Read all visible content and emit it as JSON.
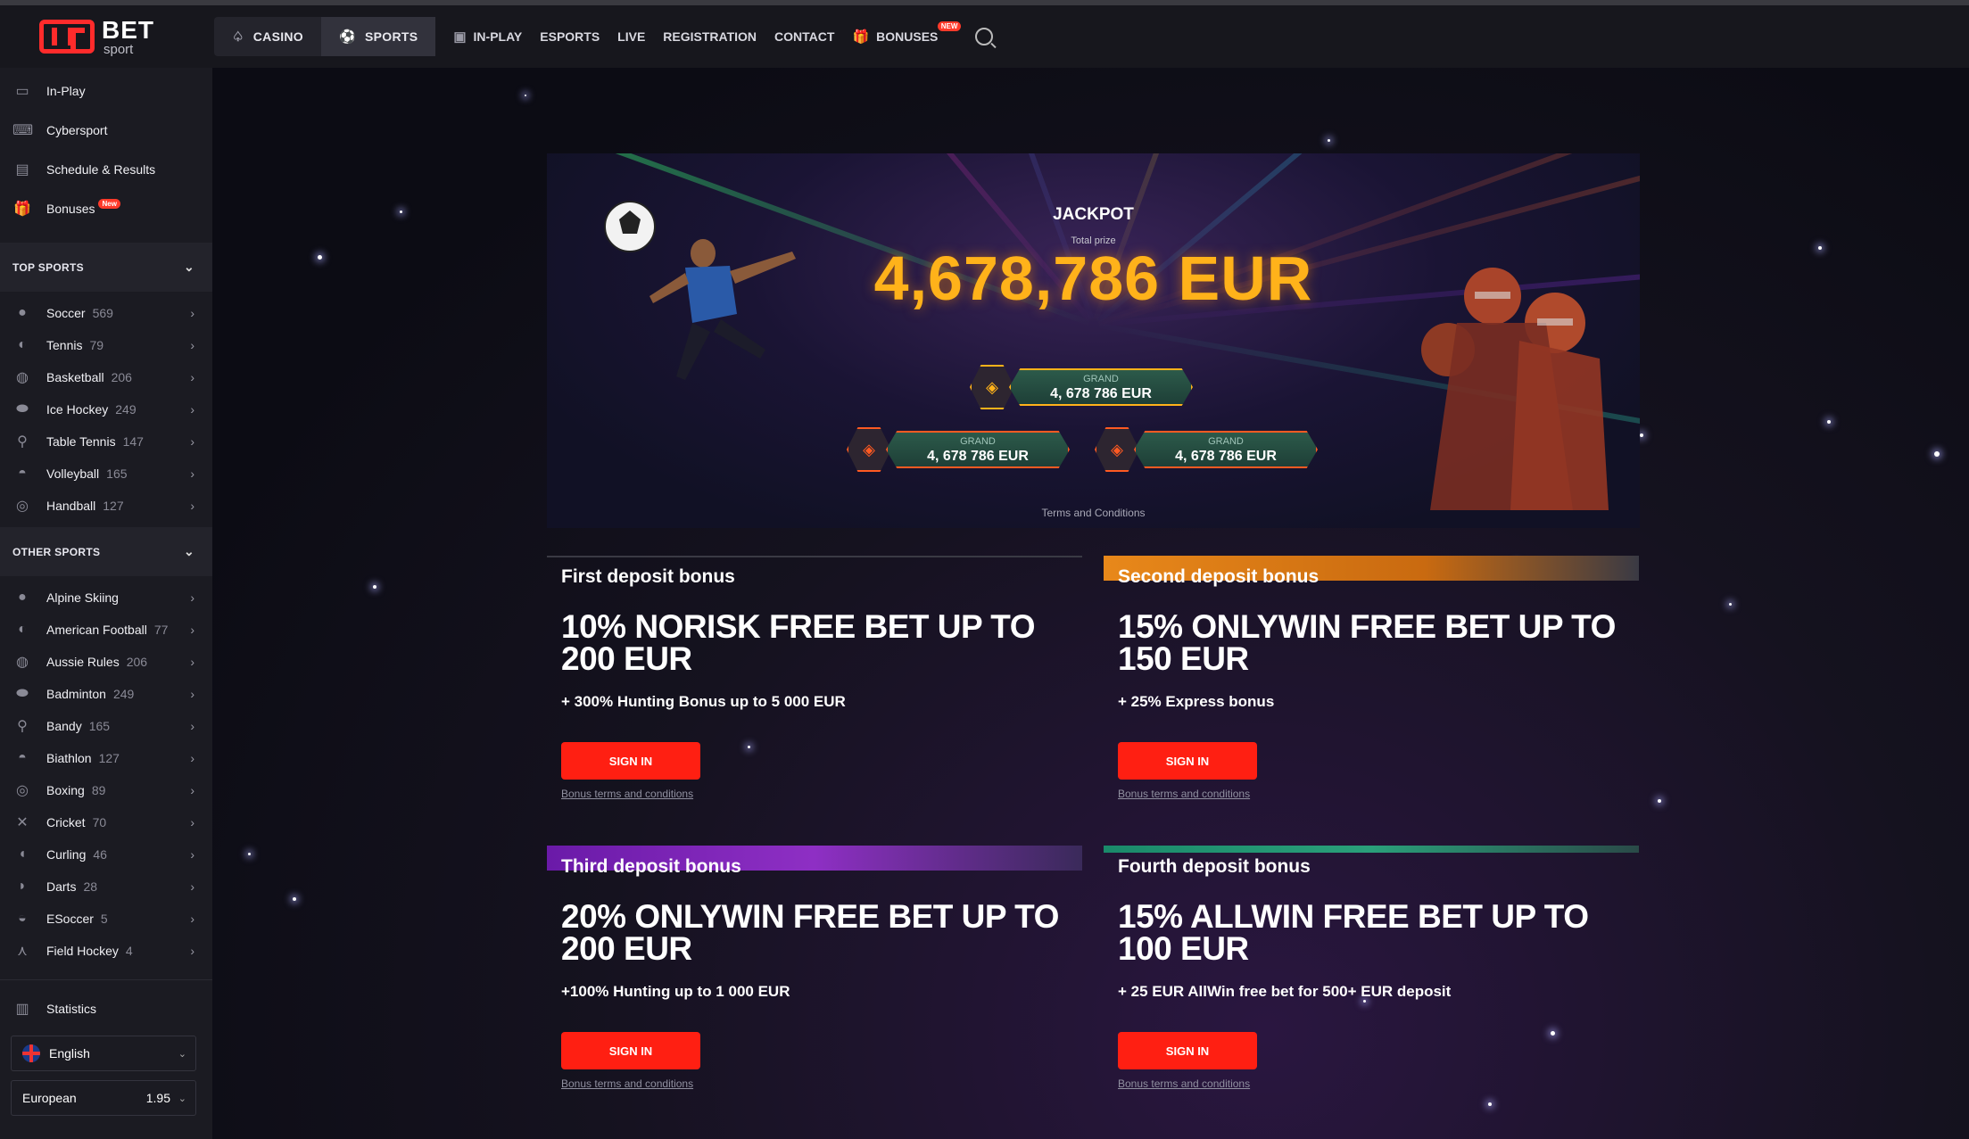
{
  "header": {
    "logo_text": "BET",
    "logo_sub": "sport",
    "tabs": [
      {
        "label": "CASINO",
        "icon": "spade-icon"
      },
      {
        "label": "SPORTS",
        "icon": "football-icon"
      }
    ],
    "links": [
      {
        "label": "IN-PLAY",
        "icon": "live-tv-icon"
      },
      {
        "label": "ESPORTS"
      },
      {
        "label": "LIVE"
      },
      {
        "label": "REGISTRATION"
      },
      {
        "label": "CONTACT"
      },
      {
        "label": "BONUSES",
        "icon": "gift-icon",
        "badge": "NEW"
      }
    ]
  },
  "sidebar": {
    "top_items": [
      {
        "label": "In-Play",
        "icon": "live-icon"
      },
      {
        "label": "Cybersport",
        "icon": "gamepad-icon"
      },
      {
        "label": "Schedule & Results",
        "icon": "clipboard-icon"
      },
      {
        "label": "Bonuses",
        "icon": "gift-icon",
        "badge": "New"
      }
    ],
    "top_sports_title": "TOP SPORTS",
    "top_sports": [
      {
        "label": "Soccer",
        "count": "569"
      },
      {
        "label": "Tennis",
        "count": "79"
      },
      {
        "label": "Basketball",
        "count": "206"
      },
      {
        "label": "Ice Hockey",
        "count": "249"
      },
      {
        "label": "Table Tennis",
        "count": "147"
      },
      {
        "label": "Volleyball",
        "count": "165"
      },
      {
        "label": "Handball",
        "count": "127"
      }
    ],
    "other_sports_title": "OTHER SPORTS",
    "other_sports": [
      {
        "label": "Alpine Skiing",
        "count": ""
      },
      {
        "label": "American Football",
        "count": "77"
      },
      {
        "label": "Aussie Rules",
        "count": "206"
      },
      {
        "label": "Badminton",
        "count": "249"
      },
      {
        "label": "Bandy",
        "count": "165"
      },
      {
        "label": "Biathlon",
        "count": "127"
      },
      {
        "label": "Boxing",
        "count": "89"
      },
      {
        "label": "Cricket",
        "count": "70"
      },
      {
        "label": "Curling",
        "count": "46"
      },
      {
        "label": "Darts",
        "count": "28"
      },
      {
        "label": "ESoccer",
        "count": "5"
      },
      {
        "label": "Field Hockey",
        "count": "4"
      }
    ],
    "statistics": "Statistics",
    "language": "English",
    "odds_format": "European",
    "odds_value": "1.95"
  },
  "jackpot": {
    "title": "JACKPOT",
    "subtitle": "Total prize",
    "amount": "4,678,786 EUR",
    "tiers": [
      {
        "label": "GRAND",
        "amount": "4, 678 786 EUR"
      },
      {
        "label": "GRAND",
        "amount": "4, 678 786 EUR"
      },
      {
        "label": "GRAND",
        "amount": "4, 678 786 EUR"
      }
    ],
    "terms": "Terms and Conditions"
  },
  "bonuses": [
    {
      "title": "First deposit bonus",
      "headline": "10% NORISK FREE BET UP TO 200 EUR",
      "sub": "+ 300% Hunting Bonus up to 5 000 EUR",
      "button": "SIGN IN",
      "terms": "Bonus terms and conditions"
    },
    {
      "title": "Second deposit bonus",
      "headline": "15% ONLYWIN FREE BET UP TO 150 EUR",
      "sub": "+ 25% Express bonus",
      "button": "SIGN IN",
      "terms": "Bonus terms and conditions"
    },
    {
      "title": "Third deposit bonus",
      "headline": "20% ONLYWIN FREE BET UP TO 200 EUR",
      "sub": "+100% Hunting up to 1 000 EUR",
      "button": "SIGN IN",
      "terms": "Bonus terms and conditions"
    },
    {
      "title": "Fourth deposit bonus",
      "headline": "15% ALLWIN FREE BET UP TO 100 EUR",
      "sub": "+ 25 EUR AllWin free bet for 500+ EUR deposit",
      "button": "SIGN IN",
      "terms": "Bonus terms and conditions"
    }
  ],
  "colors": {
    "accent": "#ff1f12",
    "jackpot_gold": "#ffb21a",
    "bg": "#0c0c14"
  }
}
